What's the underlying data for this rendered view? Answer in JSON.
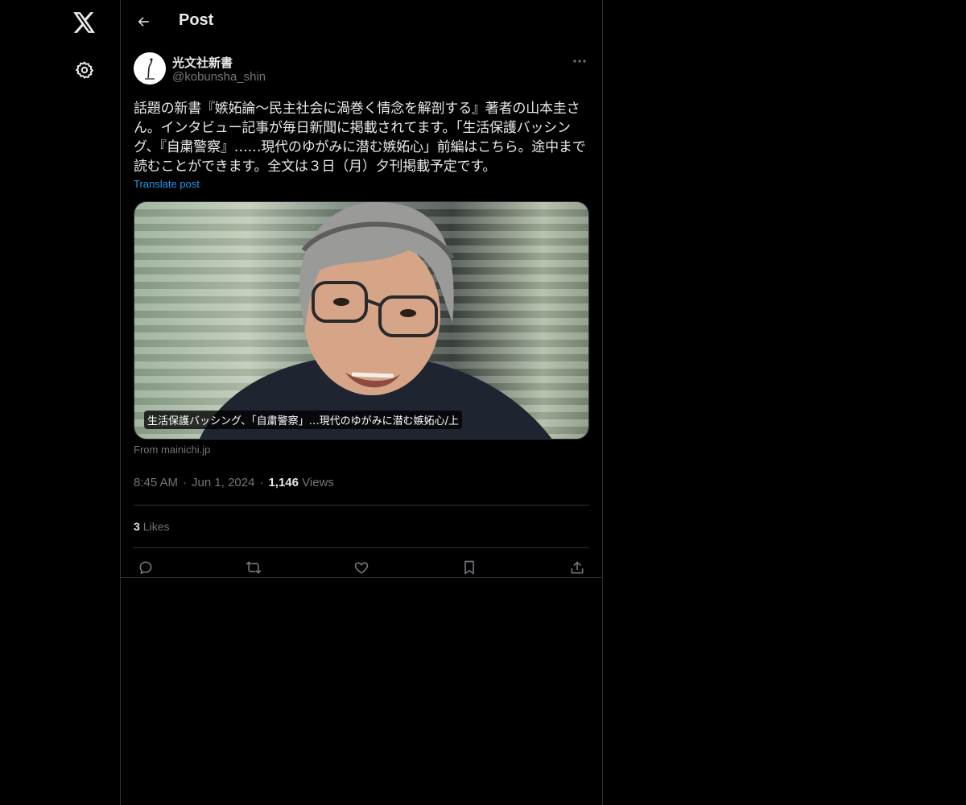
{
  "sidebar": {
    "logo_icon": "x-logo-icon",
    "settings_icon": "gear-icon"
  },
  "header": {
    "title": "Post",
    "back_icon": "arrow-left-icon"
  },
  "post": {
    "author_name": "光文社新書",
    "author_handle": "@kobunsha_shin",
    "text": "話題の新書『嫉妬論〜民主社会に渦巻く情念を解剖する』著者の山本圭さん。インタビュー記事が毎日新聞に掲載されてます。「生活保護バッシング、『自粛警察』……現代のゆがみに潜む嫉妬心」前編はこちら。途中まで読むことができます。全文は３日（月）夕刊掲載予定です。",
    "translate_label": "Translate post",
    "card": {
      "caption": "生活保護バッシング、「自粛警察」…現代のゆがみに潜む嫉妬心/上",
      "from": "From mainichi.jp"
    },
    "time": "8:45 AM",
    "date": "Jun 1, 2024",
    "views_count": "1,146",
    "views_label": "Views",
    "likes_count": "3",
    "likes_label": "Likes"
  },
  "colors": {
    "background": "#000000",
    "border": "#2f3336",
    "text_primary": "#e7e9ea",
    "text_secondary": "#71767b",
    "link": "#1d9bf0"
  }
}
